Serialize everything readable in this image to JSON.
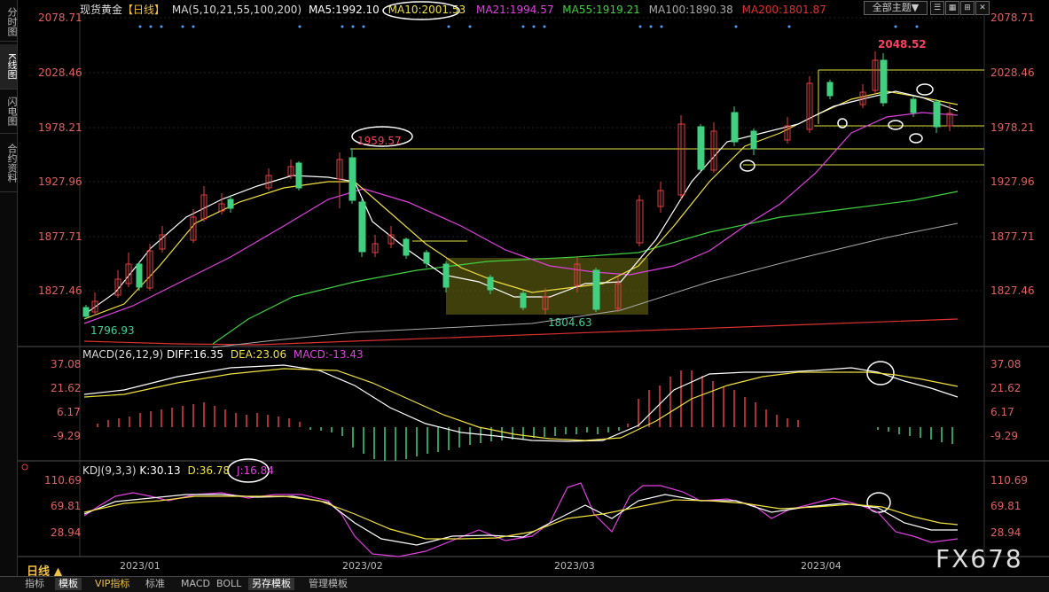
{
  "sidebar": {
    "tabs": [
      {
        "label": "分时图",
        "active": false
      },
      {
        "label": "K线图",
        "active": true
      },
      {
        "label": "闪电图",
        "active": false
      },
      {
        "label": "合约资料",
        "active": false
      }
    ]
  },
  "header": {
    "instrument": "现货黄金",
    "period_tag": "【日线】",
    "ma_label": "MA(5,10,21,55,100,200)",
    "ma5": "MA5:1992.10",
    "ma10": "MA10:2001.53",
    "ma21": "MA21:1994.57",
    "ma55": "MA55:1919.21",
    "ma100": "MA100:1890.38",
    "ma200": "MA200:1801.87",
    "theme_dropdown": "全部主题",
    "colors": {
      "ma5": "#ffffff",
      "ma10": "#f0e040",
      "ma21": "#e040e0",
      "ma55": "#40d040",
      "ma100": "#aaaaaa",
      "ma200": "#e03030",
      "up": "#e04040",
      "down": "#40d080"
    }
  },
  "price_axis": {
    "labels": [
      "2078.71",
      "2028.46",
      "1978.21",
      "1927.96",
      "1877.71",
      "1827.46"
    ]
  },
  "annotations": {
    "high": "2048.52",
    "peak_feb": "1959.57",
    "low_jan": "1796.93",
    "low_mar": "1804.63"
  },
  "macd": {
    "title": "MACD(26,12,9)",
    "diff": "DIFF:16.35",
    "dea": "DEA:23.06",
    "macd": "MACD:-13.43",
    "axis": [
      "37.08",
      "21.62",
      "6.17",
      "-9.29"
    ]
  },
  "kdj": {
    "title": "KDJ(9,3,3)",
    "k": "K:30.13",
    "d": "D:36.78",
    "j": "J:16.84",
    "axis": [
      "110.69",
      "69.81",
      "28.94"
    ]
  },
  "dates": [
    "2023/01",
    "2023/02",
    "2023/03",
    "2023/04"
  ],
  "period_button": "日线 ▲",
  "watermark": "FX678",
  "bottom_tabs": [
    {
      "label": "指标",
      "active": false
    },
    {
      "label": "模板",
      "active": true
    },
    {
      "label": "VIP指标",
      "active": false
    },
    {
      "label": "标准",
      "active": false
    },
    {
      "label": "MACD",
      "active": false
    },
    {
      "label": "BOLL",
      "active": false
    },
    {
      "label": "另存模板",
      "active": true
    },
    {
      "label": "管理模板",
      "active": false
    }
  ]
}
